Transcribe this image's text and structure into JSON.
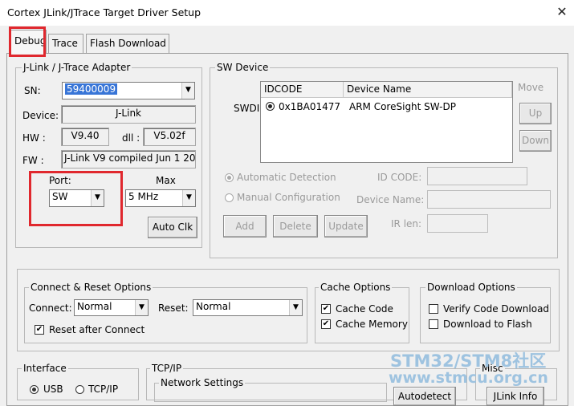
{
  "window": {
    "title": "Cortex JLink/JTrace Target Driver Setup",
    "close_glyph": "✕"
  },
  "tabs": [
    "Debug",
    "Trace",
    "Flash Download"
  ],
  "adapter": {
    "legend": "J-Link / J-Trace Adapter",
    "sn_label": "SN:",
    "sn_value": "59400009",
    "device_label": "Device:",
    "device_value": "J-Link",
    "hw_label": "HW :",
    "hw_value": "V9.40",
    "dll_label": "dll :",
    "dll_value": "V5.02f",
    "fw_label": "FW :",
    "fw_value": "J-Link V9 compiled Jun  1 20",
    "port_label": "Port:",
    "port_value": "SW",
    "max_label": "Max",
    "max_value": "5 MHz",
    "auto_clk": "Auto Clk"
  },
  "sw_device": {
    "legend": "SW Device",
    "row_label": "SWDI",
    "headers": [
      "IDCODE",
      "Device Name"
    ],
    "rows": [
      {
        "idcode": "0x1BA01477",
        "name": "ARM CoreSight SW-DP"
      }
    ],
    "move_label": "Move",
    "up": "Up",
    "down": "Down",
    "auto_detection": "Automatic Detection",
    "manual_config": "Manual Configuration",
    "id_code_label": "ID CODE:",
    "device_name_label": "Device Name:",
    "ir_len_label": "IR len:",
    "add": "Add",
    "delete": "Delete",
    "update": "Update"
  },
  "connect_reset": {
    "legend": "Connect & Reset Options",
    "connect_label": "Connect:",
    "connect_value": "Normal",
    "reset_label": "Reset:",
    "reset_value": "Normal",
    "reset_after_connect": "Reset after Connect",
    "reset_after_connect_checked": true
  },
  "cache": {
    "legend": "Cache Options",
    "cache_code": "Cache Code",
    "cache_code_checked": true,
    "cache_memory": "Cache Memory",
    "cache_memory_checked": true
  },
  "download": {
    "legend": "Download Options",
    "verify": "Verify Code Download",
    "verify_checked": false,
    "download_flash": "Download to Flash",
    "download_flash_checked": false
  },
  "interface": {
    "legend": "Interface",
    "usb": "USB",
    "tcpip": "TCP/IP"
  },
  "tcpip": {
    "legend": "TCP/IP",
    "network_settings": "Network Settings",
    "autodetect": "Autodetect"
  },
  "misc": {
    "legend": "Misc",
    "jlink_info": "JLink Info"
  },
  "watermark": {
    "line1": "STM32/STM8社区",
    "line2": "www.stmcu.org.cn"
  },
  "colors": {
    "highlight_red": "#e0282e",
    "selection_blue": "#3875d7",
    "watermark": "#9ec3e0"
  }
}
